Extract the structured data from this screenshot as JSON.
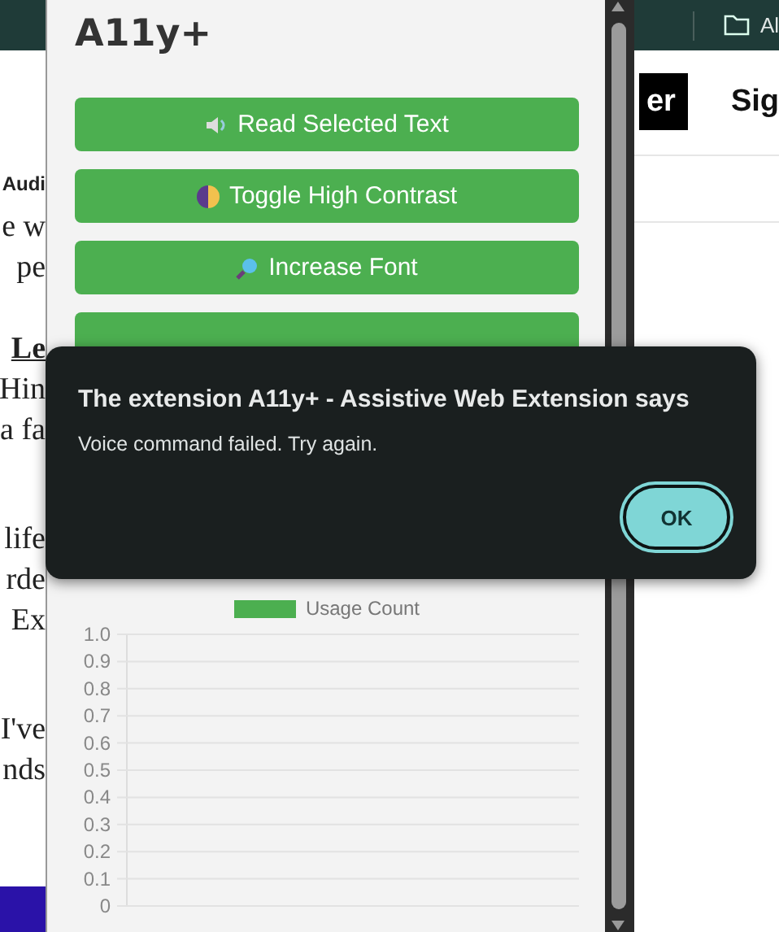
{
  "page": {
    "bookmark": {
      "label": "Al"
    },
    "nav_buttons": [
      {
        "label": "er",
        "kind": "filled"
      },
      {
        "label": "Sig",
        "kind": "plain"
      }
    ],
    "paragraphs": [
      {
        "kind": "heading",
        "lines": [
          "Audi"
        ]
      },
      {
        "kind": "text",
        "lines": [
          "e w",
          "pe"
        ]
      },
      {
        "kind": "link",
        "lines": [
          "Le"
        ]
      },
      {
        "kind": "text",
        "lines": [
          "Hin",
          "a fa"
        ]
      },
      {
        "kind": "text",
        "lines": [
          "life",
          "rde",
          "Ex"
        ]
      },
      {
        "kind": "text",
        "lines": [
          "I've",
          "nds"
        ]
      }
    ]
  },
  "popup": {
    "title": "A11y+",
    "buttons": [
      {
        "label": "Read Selected Text",
        "kind": "speaker"
      },
      {
        "label": "Toggle High Contrast",
        "kind": "contrast"
      },
      {
        "label": "Increase Font",
        "kind": "magnifier"
      },
      {
        "kind": "plain"
      }
    ],
    "chart_data": {
      "type": "bar",
      "grid": true,
      "series": [
        {
          "name": "Usage Count",
          "color": "#4caf50"
        }
      ],
      "ylim": [
        0,
        1
      ],
      "yticks": [
        0,
        0.1,
        0.2,
        0.3,
        0.4,
        0.5,
        0.6,
        0.7,
        0.8,
        0.9,
        {
          "value": 1,
          "label": "1.0"
        }
      ]
    }
  },
  "dialog": {
    "title": "The extension A11y+ - Assistive Web Extension says",
    "message": "Voice command failed. Try again.",
    "buttons": [
      "OK"
    ]
  }
}
